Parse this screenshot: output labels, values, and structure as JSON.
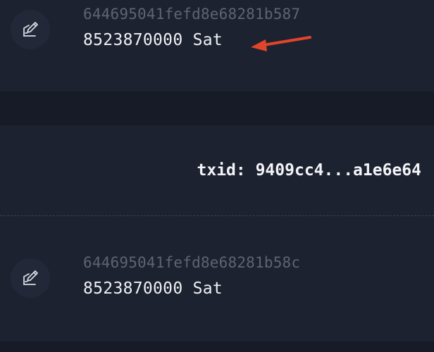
{
  "tx_top": {
    "icon": "edit-document-icon",
    "hash": "644695041fefd8e68281b587",
    "amount": "8523870000 Sat"
  },
  "txid_line": {
    "text": "txid: 9409cc4...a1e6e64"
  },
  "tx_bottom": {
    "icon": "edit-document-icon",
    "hash": "644695041fefd8e68281b58c",
    "amount": "8523870000 Sat"
  },
  "annotation": {
    "arrow_color": "#e0452b"
  },
  "colors": {
    "background": "#1d2230",
    "band": "#161b27",
    "hash_text": "#5d6474",
    "amount_text": "#eef0f4"
  }
}
